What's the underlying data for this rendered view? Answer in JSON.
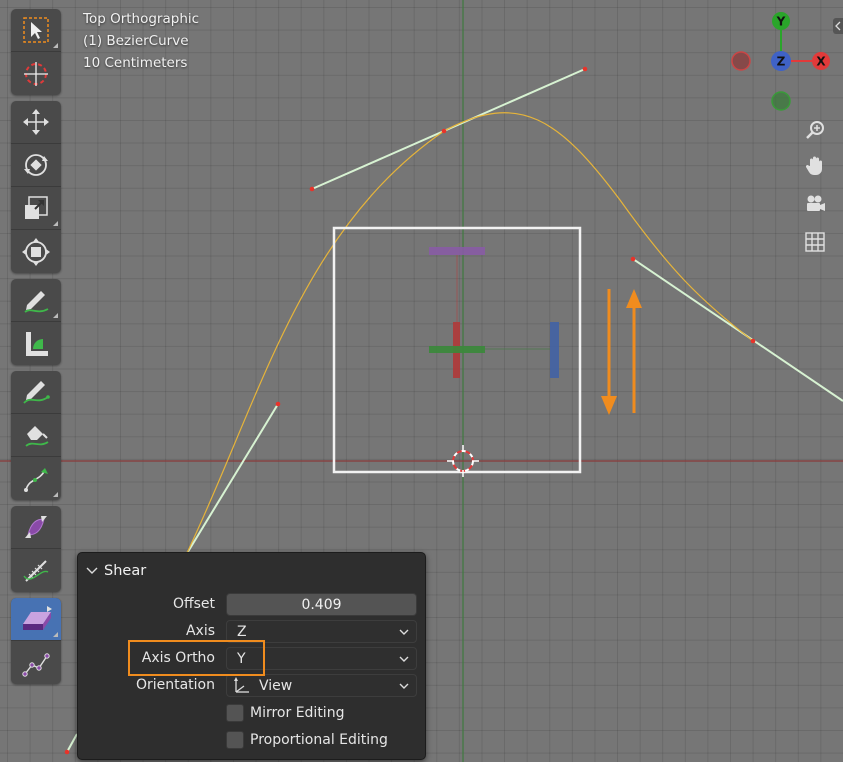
{
  "viewport": {
    "view_name": "Top Orthographic",
    "object_name": "(1) BezierCurve",
    "scale": "10 Centimeters"
  },
  "gizmo": {
    "axis_y": "Y",
    "axis_z": "Z",
    "axis_x": "X",
    "colors": {
      "x": "#e23a3a",
      "y": "#2aa52a",
      "z": "#3f62c6"
    }
  },
  "toolbar": {
    "icons": [
      "select-box-icon",
      "cursor-icon",
      "move-icon",
      "rotate-icon",
      "scale-icon",
      "transform-icon",
      "annotate-icon",
      "measure-icon",
      "draw-icon",
      "pen-icon",
      "curve-extrude-icon",
      "radius-icon",
      "tilt-icon",
      "shear-icon",
      "randomize-icon"
    ],
    "active": "shear-icon"
  },
  "panel": {
    "title": "Shear",
    "offset_label": "Offset",
    "offset_value": "0.409",
    "axis_label": "Axis",
    "axis_value": "Z",
    "axis_ortho_label": "Axis Ortho",
    "axis_ortho_value": "Y",
    "orientation_label": "Orientation",
    "orientation_value": "View",
    "mirror_label": "Mirror Editing",
    "proportional_label": "Proportional Editing"
  },
  "colors": {
    "highlight": "#f08c1e",
    "curve": "#e6b43a",
    "handle": "#d7f2d2",
    "arrow": "#f08c1e"
  }
}
